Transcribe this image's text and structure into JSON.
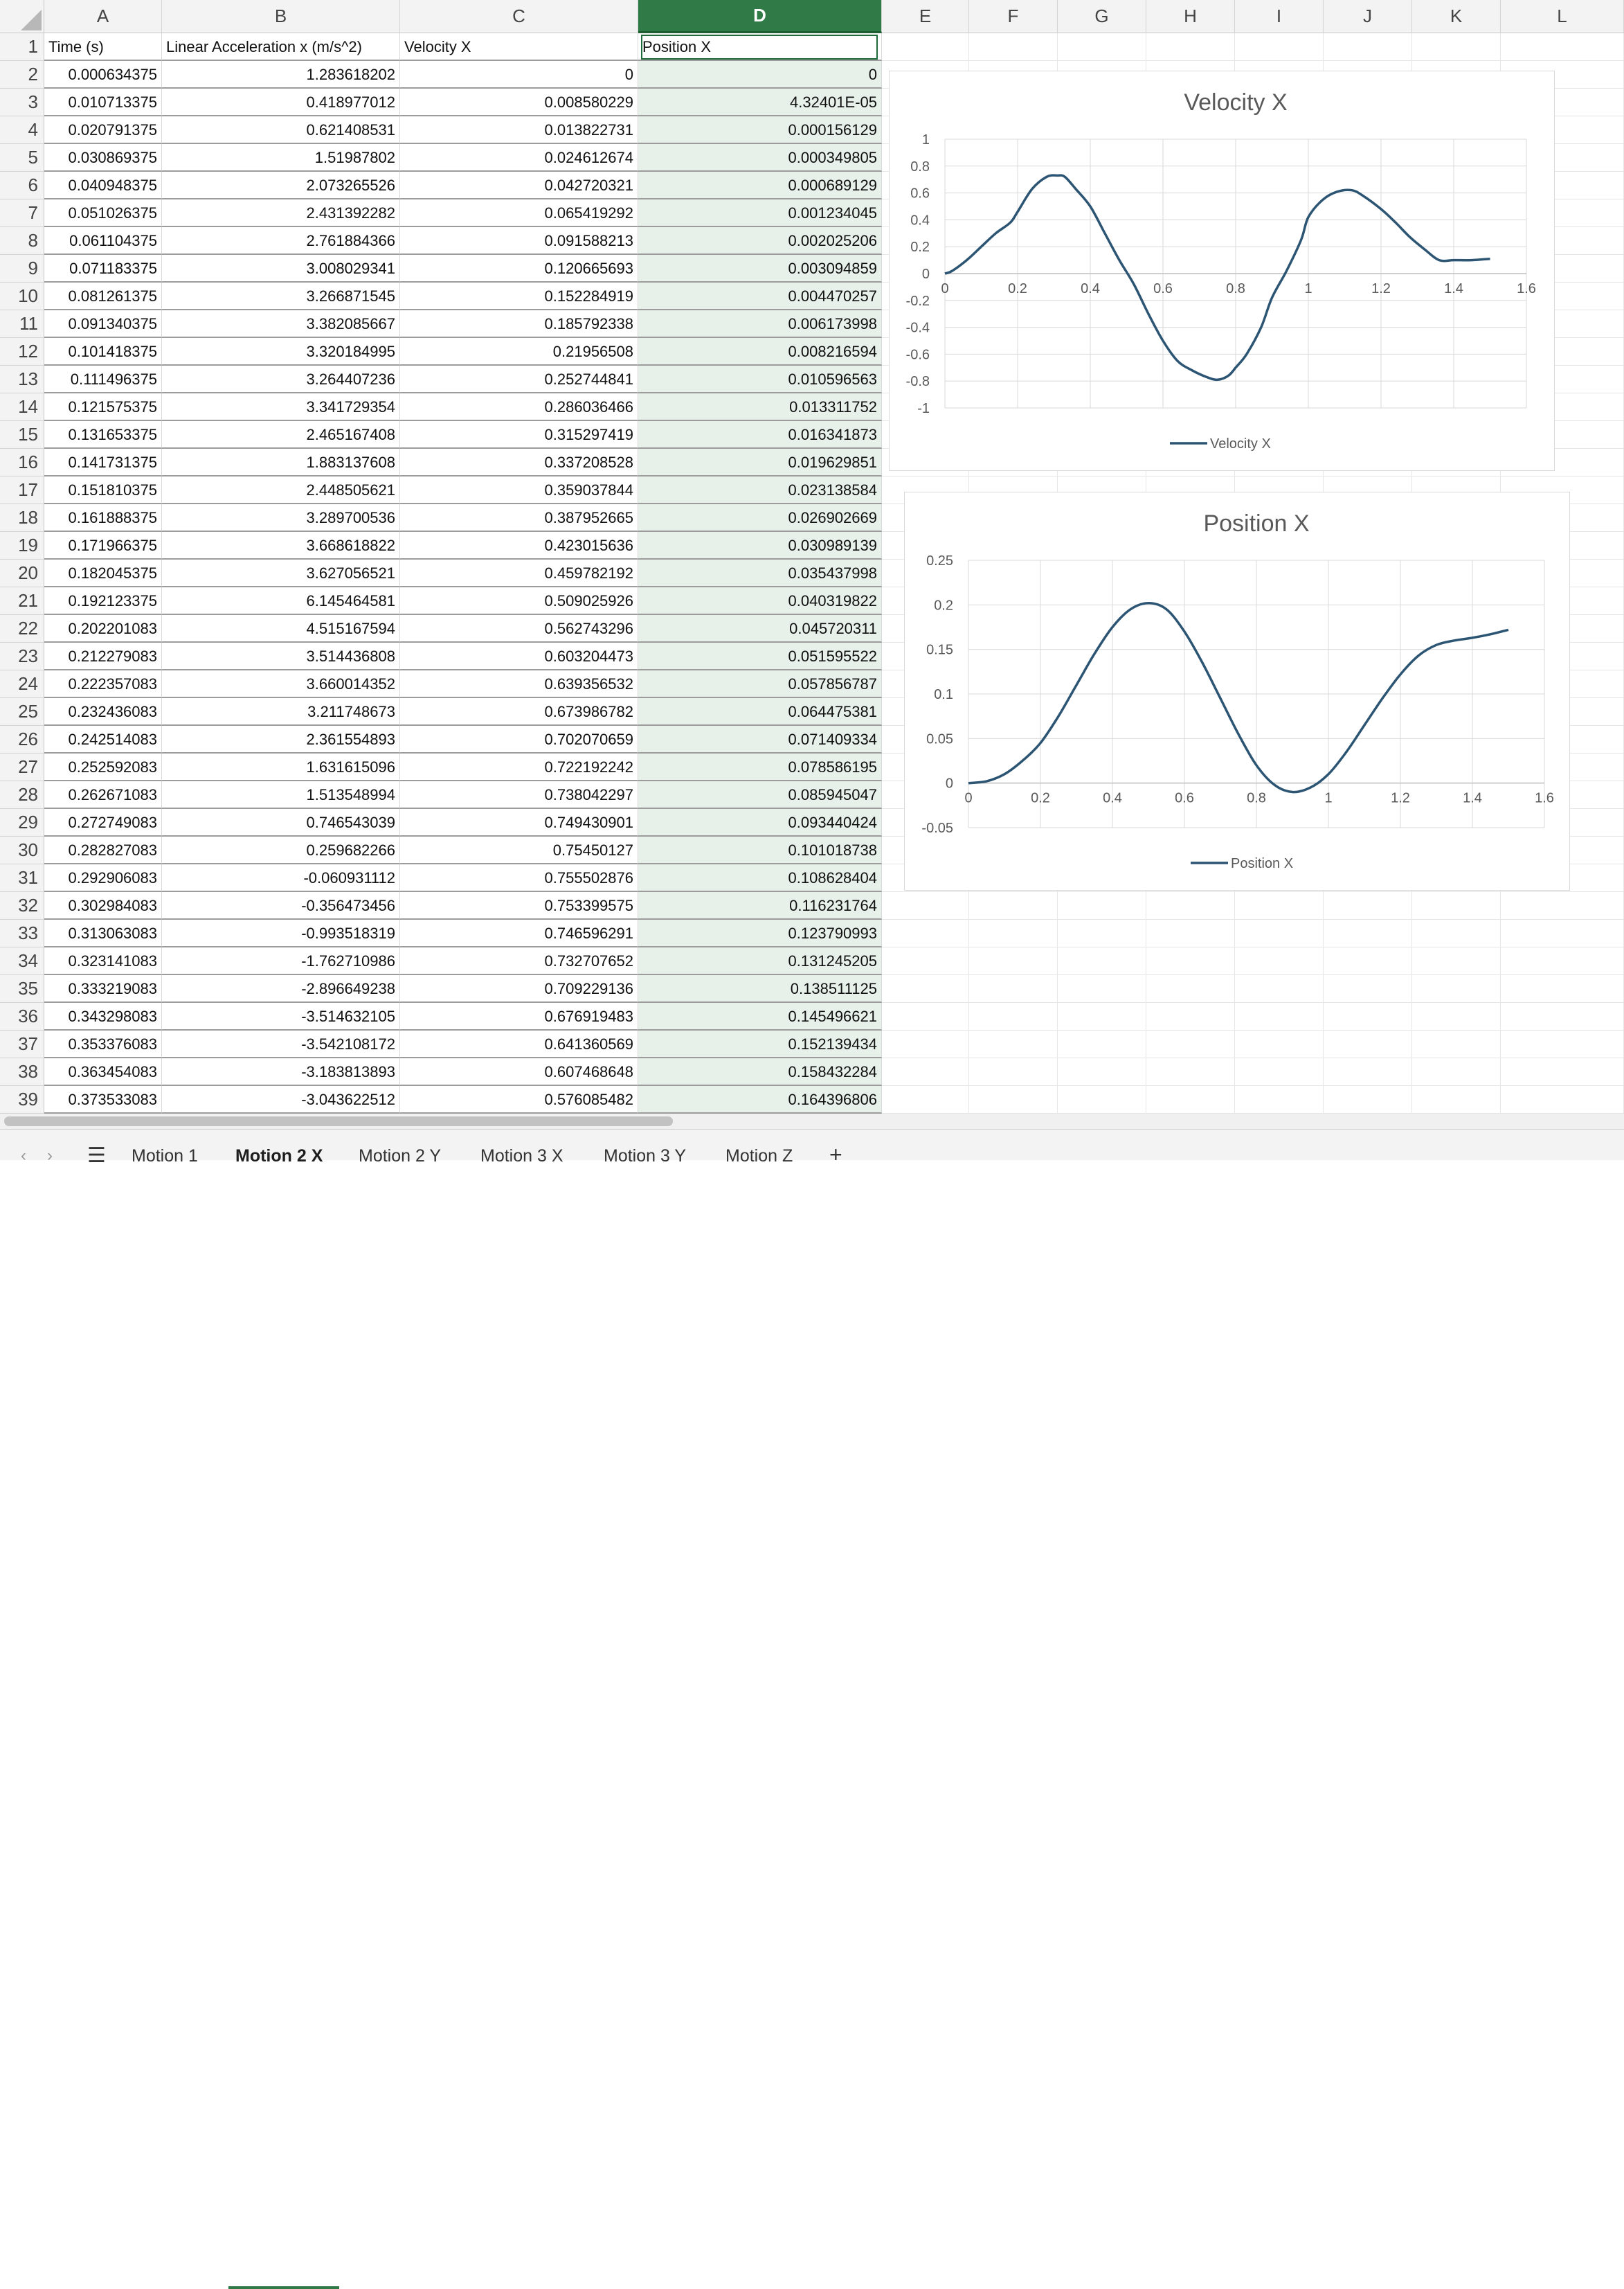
{
  "columns": [
    "A",
    "B",
    "C",
    "D",
    "E",
    "F",
    "G",
    "H",
    "I",
    "J",
    "K",
    "L"
  ],
  "selected_column": "D",
  "headers": {
    "A": "Time (s)",
    "B": "Linear Acceleration x (m/s^2)",
    "C": "Velocity X",
    "D": "Position X"
  },
  "rows": [
    [
      "0.000634375",
      "1.283618202",
      "0",
      "0"
    ],
    [
      "0.010713375",
      "0.418977012",
      "0.008580229",
      "4.32401E-05"
    ],
    [
      "0.020791375",
      "0.621408531",
      "0.013822731",
      "0.000156129"
    ],
    [
      "0.030869375",
      "1.51987802",
      "0.024612674",
      "0.000349805"
    ],
    [
      "0.040948375",
      "2.073265526",
      "0.042720321",
      "0.000689129"
    ],
    [
      "0.051026375",
      "2.431392282",
      "0.065419292",
      "0.001234045"
    ],
    [
      "0.061104375",
      "2.761884366",
      "0.091588213",
      "0.002025206"
    ],
    [
      "0.071183375",
      "3.008029341",
      "0.120665693",
      "0.003094859"
    ],
    [
      "0.081261375",
      "3.266871545",
      "0.152284919",
      "0.004470257"
    ],
    [
      "0.091340375",
      "3.382085667",
      "0.185792338",
      "0.006173998"
    ],
    [
      "0.101418375",
      "3.320184995",
      "0.21956508",
      "0.008216594"
    ],
    [
      "0.111496375",
      "3.264407236",
      "0.252744841",
      "0.010596563"
    ],
    [
      "0.121575375",
      "3.341729354",
      "0.286036466",
      "0.013311752"
    ],
    [
      "0.131653375",
      "2.465167408",
      "0.315297419",
      "0.016341873"
    ],
    [
      "0.141731375",
      "1.883137608",
      "0.337208528",
      "0.019629851"
    ],
    [
      "0.151810375",
      "2.448505621",
      "0.359037844",
      "0.023138584"
    ],
    [
      "0.161888375",
      "3.289700536",
      "0.387952665",
      "0.026902669"
    ],
    [
      "0.171966375",
      "3.668618822",
      "0.423015636",
      "0.030989139"
    ],
    [
      "0.182045375",
      "3.627056521",
      "0.459782192",
      "0.035437998"
    ],
    [
      "0.192123375",
      "6.145464581",
      "0.509025926",
      "0.040319822"
    ],
    [
      "0.202201083",
      "4.515167594",
      "0.562743296",
      "0.045720311"
    ],
    [
      "0.212279083",
      "3.514436808",
      "0.603204473",
      "0.051595522"
    ],
    [
      "0.222357083",
      "3.660014352",
      "0.639356532",
      "0.057856787"
    ],
    [
      "0.232436083",
      "3.211748673",
      "0.673986782",
      "0.064475381"
    ],
    [
      "0.242514083",
      "2.361554893",
      "0.702070659",
      "0.071409334"
    ],
    [
      "0.252592083",
      "1.631615096",
      "0.722192242",
      "0.078586195"
    ],
    [
      "0.262671083",
      "1.513548994",
      "0.738042297",
      "0.085945047"
    ],
    [
      "0.272749083",
      "0.746543039",
      "0.749430901",
      "0.093440424"
    ],
    [
      "0.282827083",
      "0.259682266",
      "0.75450127",
      "0.101018738"
    ],
    [
      "0.292906083",
      "-0.060931112",
      "0.755502876",
      "0.108628404"
    ],
    [
      "0.302984083",
      "-0.356473456",
      "0.753399575",
      "0.116231764"
    ],
    [
      "0.313063083",
      "-0.993518319",
      "0.746596291",
      "0.123790993"
    ],
    [
      "0.323141083",
      "-1.762710986",
      "0.732707652",
      "0.131245205"
    ],
    [
      "0.333219083",
      "-2.896649238",
      "0.709229136",
      "0.138511125"
    ],
    [
      "0.343298083",
      "-3.514632105",
      "0.676919483",
      "0.145496621"
    ],
    [
      "0.353376083",
      "-3.542108172",
      "0.641360569",
      "0.152139434"
    ],
    [
      "0.363454083",
      "-3.183813893",
      "0.607468648",
      "0.158432284"
    ],
    [
      "0.373533083",
      "-3.043622512",
      "0.576085482",
      "0.164396806"
    ]
  ],
  "sheet_tabs": [
    "Motion 1",
    "Motion 2 X",
    "Motion 2 Y",
    "Motion 3 X",
    "Motion 3 Y",
    "Motion Z"
  ],
  "active_tab": "Motion 2 X",
  "add_sheet_label": "+",
  "colors": {
    "accent": "#2f7a46",
    "series": "#2c5473"
  },
  "chart_data": [
    {
      "type": "line",
      "title": "Velocity X",
      "series": [
        {
          "name": "Velocity X",
          "x": [
            0,
            0.02,
            0.06,
            0.1,
            0.14,
            0.18,
            0.2,
            0.24,
            0.28,
            0.31,
            0.33,
            0.36,
            0.4,
            0.44,
            0.48,
            0.52,
            0.56,
            0.6,
            0.64,
            0.68,
            0.72,
            0.75,
            0.78,
            0.8,
            0.83,
            0.87,
            0.9,
            0.94,
            0.98,
            1.0,
            1.04,
            1.08,
            1.12,
            1.15,
            1.2,
            1.24,
            1.28,
            1.32,
            1.36,
            1.4,
            1.45,
            1.5
          ],
          "y": [
            0,
            0.02,
            0.1,
            0.2,
            0.3,
            0.38,
            0.46,
            0.63,
            0.72,
            0.73,
            0.72,
            0.63,
            0.5,
            0.3,
            0.1,
            -0.08,
            -0.3,
            -0.5,
            -0.65,
            -0.72,
            -0.77,
            -0.79,
            -0.76,
            -0.7,
            -0.6,
            -0.4,
            -0.18,
            0.02,
            0.25,
            0.42,
            0.55,
            0.61,
            0.62,
            0.58,
            0.48,
            0.38,
            0.27,
            0.18,
            0.1,
            0.1,
            0.1,
            0.11
          ]
        }
      ],
      "xlim": [
        0,
        1.6
      ],
      "ylim": [
        -1,
        1
      ],
      "xticks": [
        "0",
        "0.2",
        "0.4",
        "0.6",
        "0.8",
        "1",
        "1.2",
        "1.4",
        "1.6"
      ],
      "yticks": [
        "1",
        "0.8",
        "0.6",
        "0.4",
        "0.2",
        "0",
        "-0.2",
        "-0.4",
        "-0.6",
        "-0.8",
        "-1"
      ],
      "grid": true,
      "legend": "bottom"
    },
    {
      "type": "line",
      "title": "Position X",
      "series": [
        {
          "name": "Position X",
          "x": [
            0,
            0.05,
            0.1,
            0.15,
            0.2,
            0.25,
            0.3,
            0.35,
            0.4,
            0.45,
            0.5,
            0.55,
            0.6,
            0.65,
            0.7,
            0.75,
            0.8,
            0.85,
            0.9,
            0.95,
            1.0,
            1.05,
            1.1,
            1.15,
            1.2,
            1.25,
            1.3,
            1.35,
            1.4,
            1.45,
            1.5
          ],
          "y": [
            0,
            0.002,
            0.01,
            0.025,
            0.045,
            0.075,
            0.11,
            0.145,
            0.175,
            0.195,
            0.202,
            0.195,
            0.17,
            0.135,
            0.095,
            0.055,
            0.02,
            -0.002,
            -0.01,
            -0.005,
            0.01,
            0.035,
            0.065,
            0.095,
            0.122,
            0.143,
            0.155,
            0.16,
            0.163,
            0.167,
            0.172
          ]
        }
      ],
      "xlim": [
        0,
        1.6
      ],
      "ylim": [
        -0.05,
        0.25
      ],
      "xticks": [
        "0",
        "0.2",
        "0.4",
        "0.6",
        "0.8",
        "1",
        "1.2",
        "1.4",
        "1.6"
      ],
      "yticks": [
        "0.25",
        "0.2",
        "0.15",
        "0.1",
        "0.05",
        "0",
        "-0.05"
      ],
      "grid": true,
      "legend": "bottom"
    }
  ]
}
